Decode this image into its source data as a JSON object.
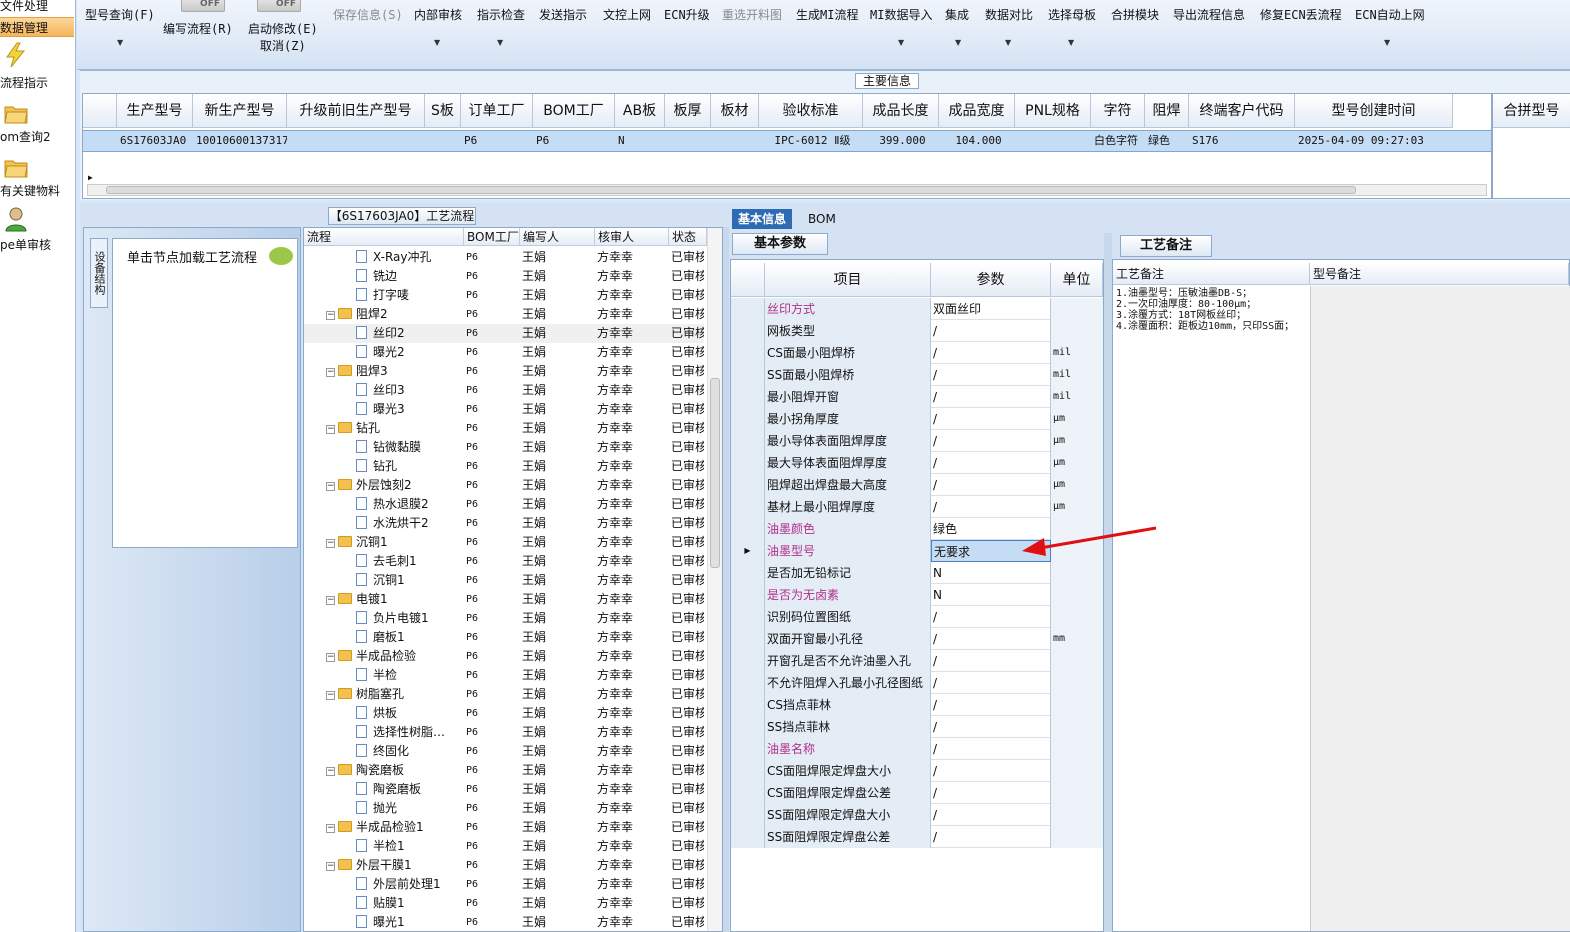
{
  "left_nav": {
    "items": [
      {
        "label": "文件处理"
      },
      {
        "label": "数据管理"
      },
      {
        "label": "流程指示"
      },
      {
        "label": "om查询2"
      },
      {
        "label": "有关键物料"
      },
      {
        "label": "pe单审核"
      }
    ]
  },
  "toolbar": {
    "items": [
      {
        "label": "型号查询(F)"
      },
      {
        "label": "编写流程(R)"
      },
      {
        "label": "启动修改(E)"
      },
      {
        "label": "取消(Z)"
      },
      {
        "label": "保存信息(S)"
      },
      {
        "label": "内部审核"
      },
      {
        "label": "指示检查"
      },
      {
        "label": "发送指示"
      },
      {
        "label": "文控上网"
      },
      {
        "label": "ECN升级"
      },
      {
        "label": "重选开料图"
      },
      {
        "label": "生成MI流程"
      },
      {
        "label": "MI数据导入"
      },
      {
        "label": "集成"
      },
      {
        "label": "数据对比"
      },
      {
        "label": "选择母板"
      },
      {
        "label": "合拼模块"
      },
      {
        "label": "导出流程信息"
      },
      {
        "label": "修复ECN丢流程"
      },
      {
        "label": "ECN自动上网"
      }
    ],
    "toggle_label": "OFF"
  },
  "main_info": {
    "title": "主要信息",
    "columns": [
      "生产型号",
      "新生产型号",
      "升级前旧生产型号",
      "S板",
      "订单工厂",
      "BOM工厂",
      "AB板",
      "板厚",
      "板材",
      "验收标准",
      "成品长度",
      "成品宽度",
      "PNL规格",
      "字符",
      "阻焊",
      "终端客户代码",
      "型号创建时间"
    ],
    "extra_column": "合拼型号",
    "row": {
      "生产型号": "6S17603JA0",
      "新生产型号": "10010600137317",
      "订单工厂": "P6",
      "BOM工厂": "P6",
      "AB板": "N",
      "验收标准": "IPC-6012 Ⅱ级",
      "成品长度": "399.000",
      "成品宽度": "104.000",
      "字符": "白色字符",
      "阻焊": "绿色",
      "终端客户代码": "S176",
      "型号创建时间": "2025-04-09 09:27:03"
    }
  },
  "flow": {
    "tab_title": "【6S17603JA0】工艺流程",
    "side_tab": "设备结构",
    "load_hint": "单击节点加载工艺流程",
    "columns": [
      "流程",
      "BOM工厂",
      "编写人",
      "核审人",
      "状态"
    ],
    "rows": [
      {
        "name": "X-Ray冲孔",
        "type": "doc",
        "bom": "P6",
        "writer": "王娟",
        "reviewer": "方幸幸",
        "status": "已审核"
      },
      {
        "name": "铣边",
        "type": "doc",
        "bom": "P6",
        "writer": "王娟",
        "reviewer": "方幸幸",
        "status": "已审核"
      },
      {
        "name": "打字唛",
        "type": "doc",
        "bom": "P6",
        "writer": "王娟",
        "reviewer": "方幸幸",
        "status": "已审核"
      },
      {
        "name": "阻焊2",
        "type": "folder",
        "bom": "P6",
        "writer": "王娟",
        "reviewer": "方幸幸",
        "status": "已审核"
      },
      {
        "name": "丝印2",
        "type": "doc",
        "bom": "P6",
        "writer": "王娟",
        "reviewer": "方幸幸",
        "status": "已审核",
        "selected": true
      },
      {
        "name": "曝光2",
        "type": "doc",
        "bom": "P6",
        "writer": "王娟",
        "reviewer": "方幸幸",
        "status": "已审核"
      },
      {
        "name": "阻焊3",
        "type": "folder",
        "bom": "P6",
        "writer": "王娟",
        "reviewer": "方幸幸",
        "status": "已审核"
      },
      {
        "name": "丝印3",
        "type": "doc",
        "bom": "P6",
        "writer": "王娟",
        "reviewer": "方幸幸",
        "status": "已审核"
      },
      {
        "name": "曝光3",
        "type": "doc",
        "bom": "P6",
        "writer": "王娟",
        "reviewer": "方幸幸",
        "status": "已审核"
      },
      {
        "name": "钻孔",
        "type": "folder",
        "bom": "P6",
        "writer": "王娟",
        "reviewer": "方幸幸",
        "status": "已审核"
      },
      {
        "name": "钻微黏膜",
        "type": "doc",
        "bom": "P6",
        "writer": "王娟",
        "reviewer": "方幸幸",
        "status": "已审核"
      },
      {
        "name": "钻孔",
        "type": "doc",
        "bom": "P6",
        "writer": "王娟",
        "reviewer": "方幸幸",
        "status": "已审核"
      },
      {
        "name": "外层蚀刻2",
        "type": "folder",
        "bom": "P6",
        "writer": "王娟",
        "reviewer": "方幸幸",
        "status": "已审核"
      },
      {
        "name": "热水退膜2",
        "type": "doc",
        "bom": "P6",
        "writer": "王娟",
        "reviewer": "方幸幸",
        "status": "已审核"
      },
      {
        "name": "水洗烘干2",
        "type": "doc",
        "bom": "P6",
        "writer": "王娟",
        "reviewer": "方幸幸",
        "status": "已审核"
      },
      {
        "name": "沉铜1",
        "type": "folder",
        "bom": "P6",
        "writer": "王娟",
        "reviewer": "方幸幸",
        "status": "已审核"
      },
      {
        "name": "去毛刺1",
        "type": "doc",
        "bom": "P6",
        "writer": "王娟",
        "reviewer": "方幸幸",
        "status": "已审核"
      },
      {
        "name": "沉铜1",
        "type": "doc",
        "bom": "P6",
        "writer": "王娟",
        "reviewer": "方幸幸",
        "status": "已审核"
      },
      {
        "name": "电镀1",
        "type": "folder",
        "bom": "P6",
        "writer": "王娟",
        "reviewer": "方幸幸",
        "status": "已审核"
      },
      {
        "name": "负片电镀1",
        "type": "doc",
        "bom": "P6",
        "writer": "王娟",
        "reviewer": "方幸幸",
        "status": "已审核"
      },
      {
        "name": "磨板1",
        "type": "doc",
        "bom": "P6",
        "writer": "王娟",
        "reviewer": "方幸幸",
        "status": "已审核"
      },
      {
        "name": "半成品检验",
        "type": "folder",
        "bom": "P6",
        "writer": "王娟",
        "reviewer": "方幸幸",
        "status": "已审核"
      },
      {
        "name": "半检",
        "type": "doc",
        "bom": "P6",
        "writer": "王娟",
        "reviewer": "方幸幸",
        "status": "已审核"
      },
      {
        "name": "树脂塞孔",
        "type": "folder",
        "bom": "P6",
        "writer": "王娟",
        "reviewer": "方幸幸",
        "status": "已审核"
      },
      {
        "name": "烘板",
        "type": "doc",
        "bom": "P6",
        "writer": "王娟",
        "reviewer": "方幸幸",
        "status": "已审核"
      },
      {
        "name": "选择性树脂…",
        "type": "doc",
        "bom": "P6",
        "writer": "王娟",
        "reviewer": "方幸幸",
        "status": "已审核"
      },
      {
        "name": "终固化",
        "type": "doc",
        "bom": "P6",
        "writer": "王娟",
        "reviewer": "方幸幸",
        "status": "已审核"
      },
      {
        "name": "陶瓷磨板",
        "type": "folder",
        "bom": "P6",
        "writer": "王娟",
        "reviewer": "方幸幸",
        "status": "已审核"
      },
      {
        "name": "陶瓷磨板",
        "type": "doc",
        "bom": "P6",
        "writer": "王娟",
        "reviewer": "方幸幸",
        "status": "已审核"
      },
      {
        "name": "抛光",
        "type": "doc",
        "bom": "P6",
        "writer": "王娟",
        "reviewer": "方幸幸",
        "status": "已审核"
      },
      {
        "name": "半成品检验1",
        "type": "folder",
        "bom": "P6",
        "writer": "王娟",
        "reviewer": "方幸幸",
        "status": "已审核"
      },
      {
        "name": "半检1",
        "type": "doc",
        "bom": "P6",
        "writer": "王娟",
        "reviewer": "方幸幸",
        "status": "已审核"
      },
      {
        "name": "外层干膜1",
        "type": "folder",
        "bom": "P6",
        "writer": "王娟",
        "reviewer": "方幸幸",
        "status": "已审核"
      },
      {
        "name": "外层前处理1",
        "type": "doc",
        "bom": "P6",
        "writer": "王娟",
        "reviewer": "方幸幸",
        "status": "已审核"
      },
      {
        "name": "贴膜1",
        "type": "doc",
        "bom": "P6",
        "writer": "王娟",
        "reviewer": "方幸幸",
        "status": "已审核"
      },
      {
        "name": "曝光1",
        "type": "doc",
        "bom": "P6",
        "writer": "王娟",
        "reviewer": "方幸幸",
        "status": "已审核"
      }
    ]
  },
  "info": {
    "tabs": [
      "基本信息",
      "BOM"
    ],
    "sub_tab": "基本参数",
    "columns": [
      "项目",
      "参数",
      "单位"
    ],
    "rows": [
      {
        "k": "丝印方式",
        "v": "双面丝印",
        "u": "",
        "pink": true
      },
      {
        "k": "网板类型",
        "v": "/",
        "u": ""
      },
      {
        "k": "CS面最小阻焊桥",
        "v": "/",
        "u": "mil"
      },
      {
        "k": "SS面最小阻焊桥",
        "v": "/",
        "u": "mil"
      },
      {
        "k": "最小阻焊开窗",
        "v": "/",
        "u": "mil"
      },
      {
        "k": "最小拐角厚度",
        "v": "/",
        "u": "μm"
      },
      {
        "k": "最小导体表面阻焊厚度",
        "v": "/",
        "u": "μm"
      },
      {
        "k": "最大导体表面阻焊厚度",
        "v": "/",
        "u": "μm"
      },
      {
        "k": "阻焊超出焊盘最大高度",
        "v": "/",
        "u": "μm"
      },
      {
        "k": "基材上最小阻焊厚度",
        "v": "/",
        "u": "μm"
      },
      {
        "k": "油墨颜色",
        "v": "绿色",
        "u": "",
        "pink": true
      },
      {
        "k": "油墨型号",
        "v": "无要求",
        "u": "",
        "pink": true,
        "selected": true
      },
      {
        "k": "是否加无铅标记",
        "v": "N",
        "u": ""
      },
      {
        "k": "是否为无卤素",
        "v": "N",
        "u": "",
        "pink": true
      },
      {
        "k": "识别码位置图纸",
        "v": "/",
        "u": ""
      },
      {
        "k": "双面开窗最小孔径",
        "v": "/",
        "u": "mm"
      },
      {
        "k": "开窗孔是否不允许油墨入孔",
        "v": "/",
        "u": ""
      },
      {
        "k": "不允许阻焊入孔最小孔径图纸",
        "v": "/",
        "u": ""
      },
      {
        "k": "CS挡点菲林",
        "v": "/",
        "u": ""
      },
      {
        "k": "SS挡点菲林",
        "v": "/",
        "u": ""
      },
      {
        "k": "油墨名称",
        "v": "/",
        "u": "",
        "pink": true
      },
      {
        "k": "CS面阻焊限定焊盘大小",
        "v": "/",
        "u": ""
      },
      {
        "k": "CS面阻焊限定焊盘公差",
        "v": "/",
        "u": ""
      },
      {
        "k": "SS面阻焊限定焊盘大小",
        "v": "/",
        "u": ""
      },
      {
        "k": "SS面阻焊限定焊盘公差",
        "v": "/",
        "u": ""
      }
    ]
  },
  "remark": {
    "tab": "工艺备注",
    "columns": [
      "工艺备注",
      "型号备注"
    ],
    "text": "1.油墨型号：压敏油墨DB-S；\n2.一次印油厚度：80-100μm；\n3.涂覆方式：18T网板丝印；\n4.涂覆面积：距板边10mm，只印SS面；"
  },
  "colors": {
    "accent": "#2f6bb5",
    "pink": "#b0308a",
    "arrow": "#e01010",
    "selected_row": "#c5dcf5"
  }
}
